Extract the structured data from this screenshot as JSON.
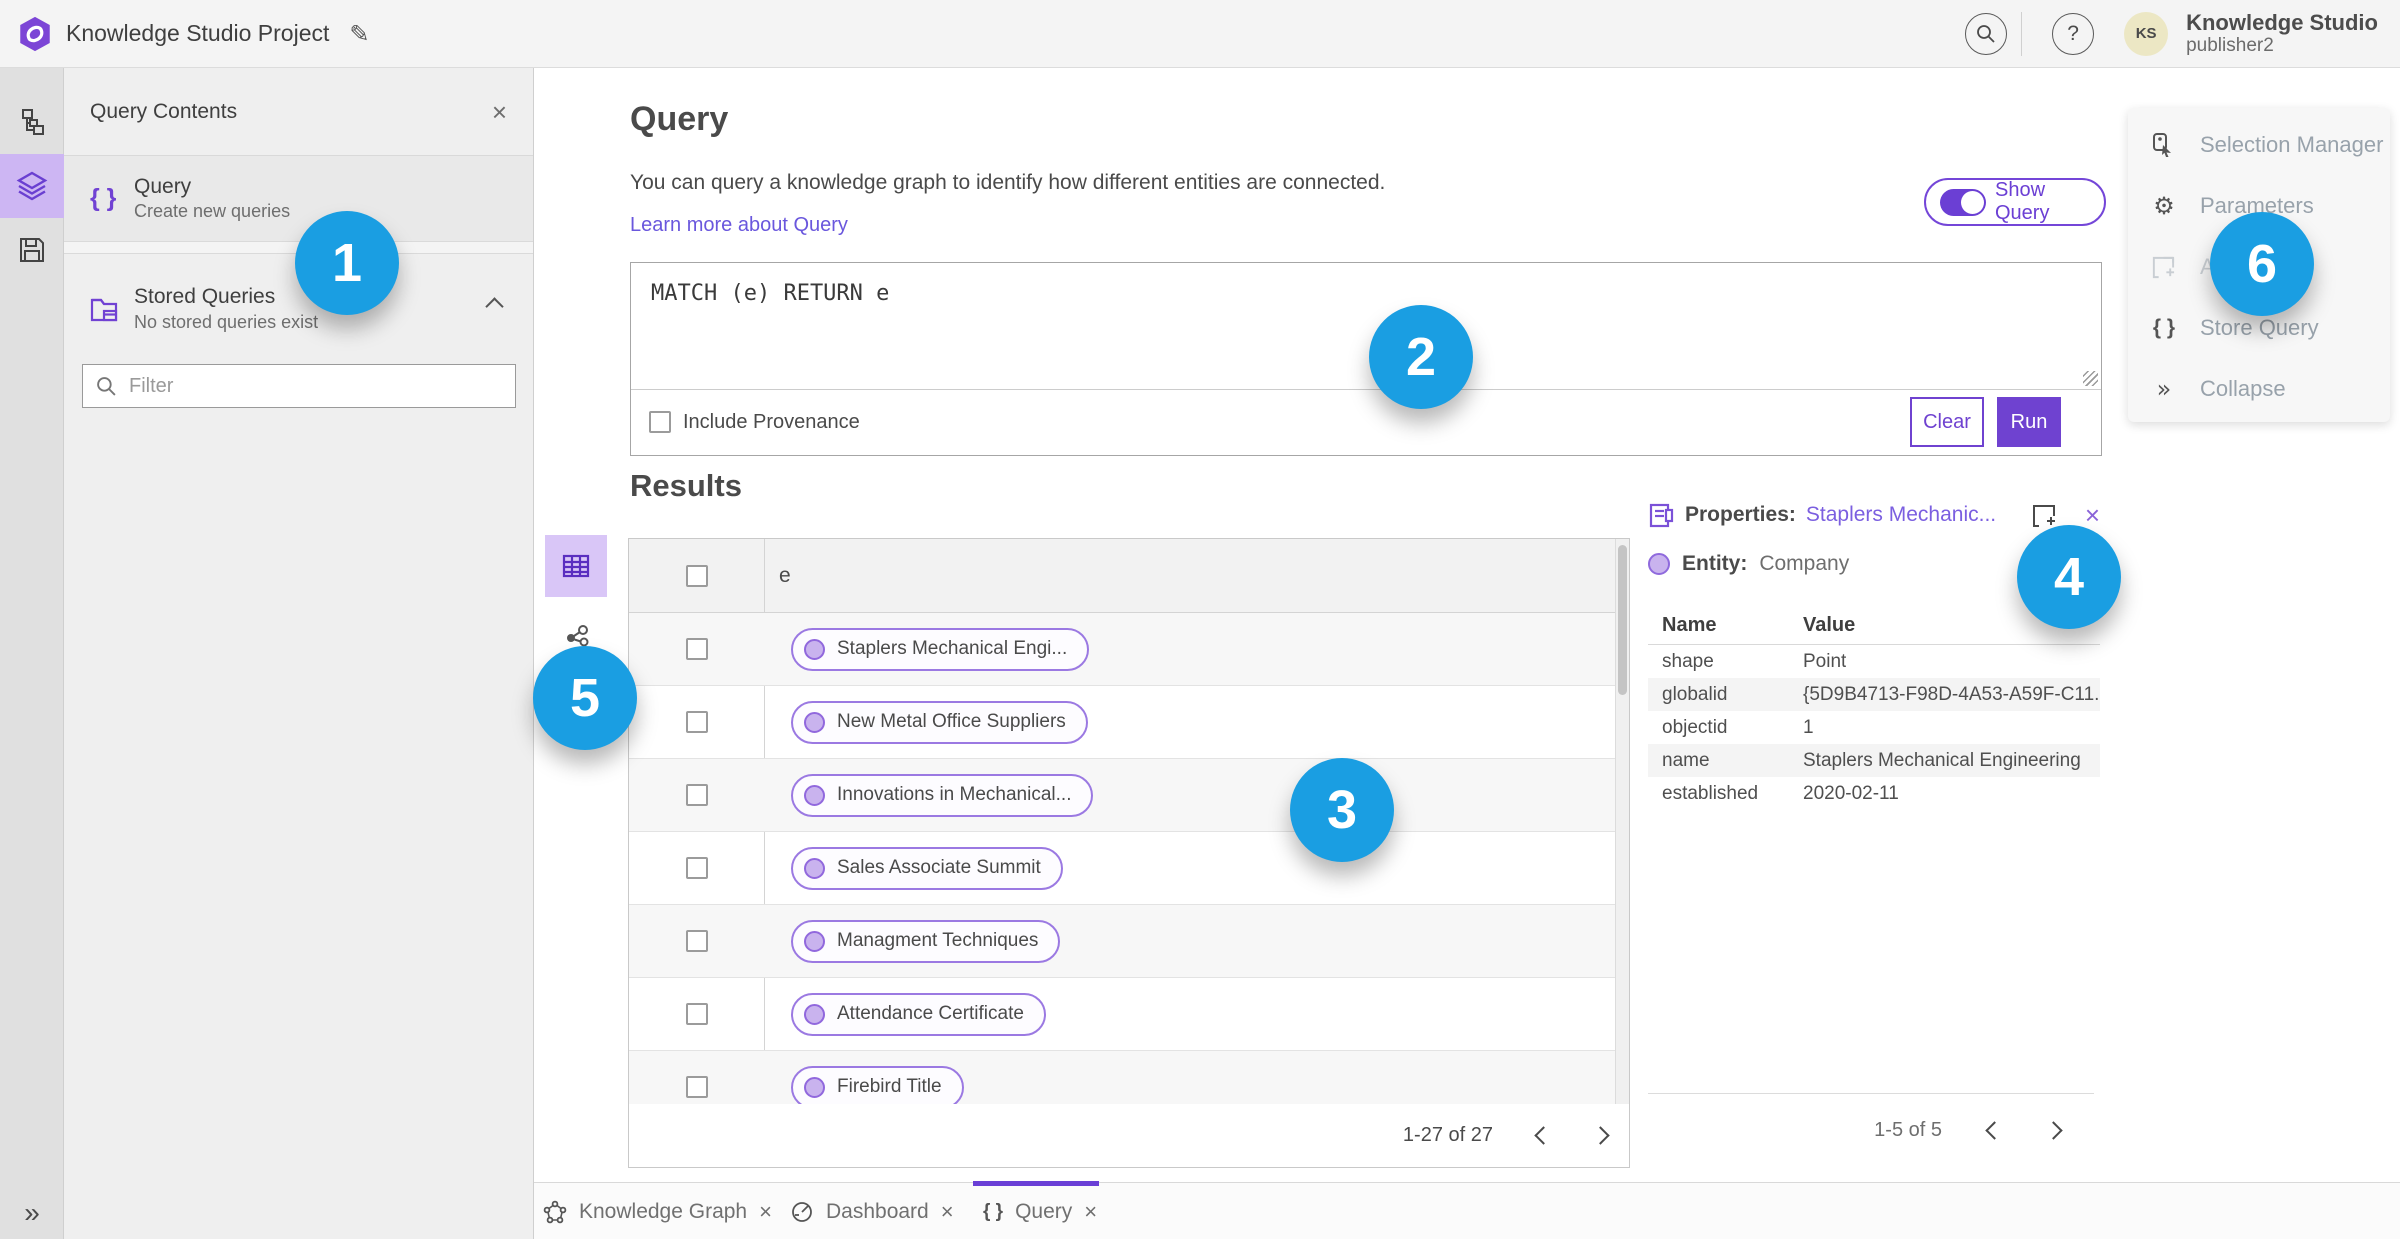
{
  "colors": {
    "accent_purple": "#6f42d0",
    "callout_blue": "#1a9ee2",
    "link_purple": "#6a57dd"
  },
  "header": {
    "title": "Knowledge Studio Project",
    "user_name": "Knowledge Studio",
    "user_role": "publisher2",
    "avatar_initials": "KS"
  },
  "icons": {
    "pencil": "✎",
    "question_mark": "?",
    "braces": "{ }",
    "gear": "⚙",
    "collapse_chevrons": "»",
    "expand_chevrons": "»",
    "close": "×"
  },
  "query_contents": {
    "title": "Query Contents",
    "items": [
      {
        "label": "Query",
        "sublabel": "Create new queries"
      },
      {
        "label": "Stored Queries",
        "sublabel": "No stored queries exist"
      }
    ],
    "filter_placeholder": "Filter"
  },
  "query_section": {
    "title": "Query",
    "description": "You can query a knowledge graph to identify how different entities are connected.",
    "learn_more_link": "Learn more about Query",
    "show_query_label": "Show Query",
    "query_text": "MATCH (e) RETURN e",
    "include_provenance_label": "Include Provenance",
    "clear_button": "Clear",
    "run_button": "Run"
  },
  "results": {
    "title": "Results",
    "column_header": "e",
    "rows": [
      "Staplers Mechanical Engi...",
      "New Metal Office Suppliers",
      "Innovations in Mechanical...",
      "Sales Associate Summit",
      "Managment Techniques",
      "Attendance Certificate",
      "Firebird Title"
    ],
    "pagination": "1-27 of 27"
  },
  "properties_panel": {
    "title": "Properties:",
    "entity_link": "Staplers Mechanic...",
    "entity_label": "Entity:",
    "entity_type": "Company",
    "columns": {
      "name": "Name",
      "value": "Value"
    },
    "rows": [
      {
        "name": "shape",
        "value": "Point"
      },
      {
        "name": "globalid",
        "value": "{5D9B4713-F98D-4A53-A59F-C11..."
      },
      {
        "name": "objectid",
        "value": "1"
      },
      {
        "name": "name",
        "value": "Staplers Mechanical Engineering"
      },
      {
        "name": "established",
        "value": "2020-02-11"
      }
    ],
    "pagination": "1-5 of 5"
  },
  "side_menu": {
    "items": [
      {
        "label": "Selection Manager"
      },
      {
        "label": "Parameters"
      },
      {
        "label": "Ad"
      },
      {
        "label": "Store Query"
      },
      {
        "label": "Collapse"
      }
    ]
  },
  "bottom_tabs": [
    {
      "label": "Knowledge Graph"
    },
    {
      "label": "Dashboard"
    },
    {
      "label": "Query"
    }
  ],
  "callouts": [
    {
      "number": "1"
    },
    {
      "number": "2"
    },
    {
      "number": "3"
    },
    {
      "number": "4"
    },
    {
      "number": "5"
    },
    {
      "number": "6"
    }
  ]
}
